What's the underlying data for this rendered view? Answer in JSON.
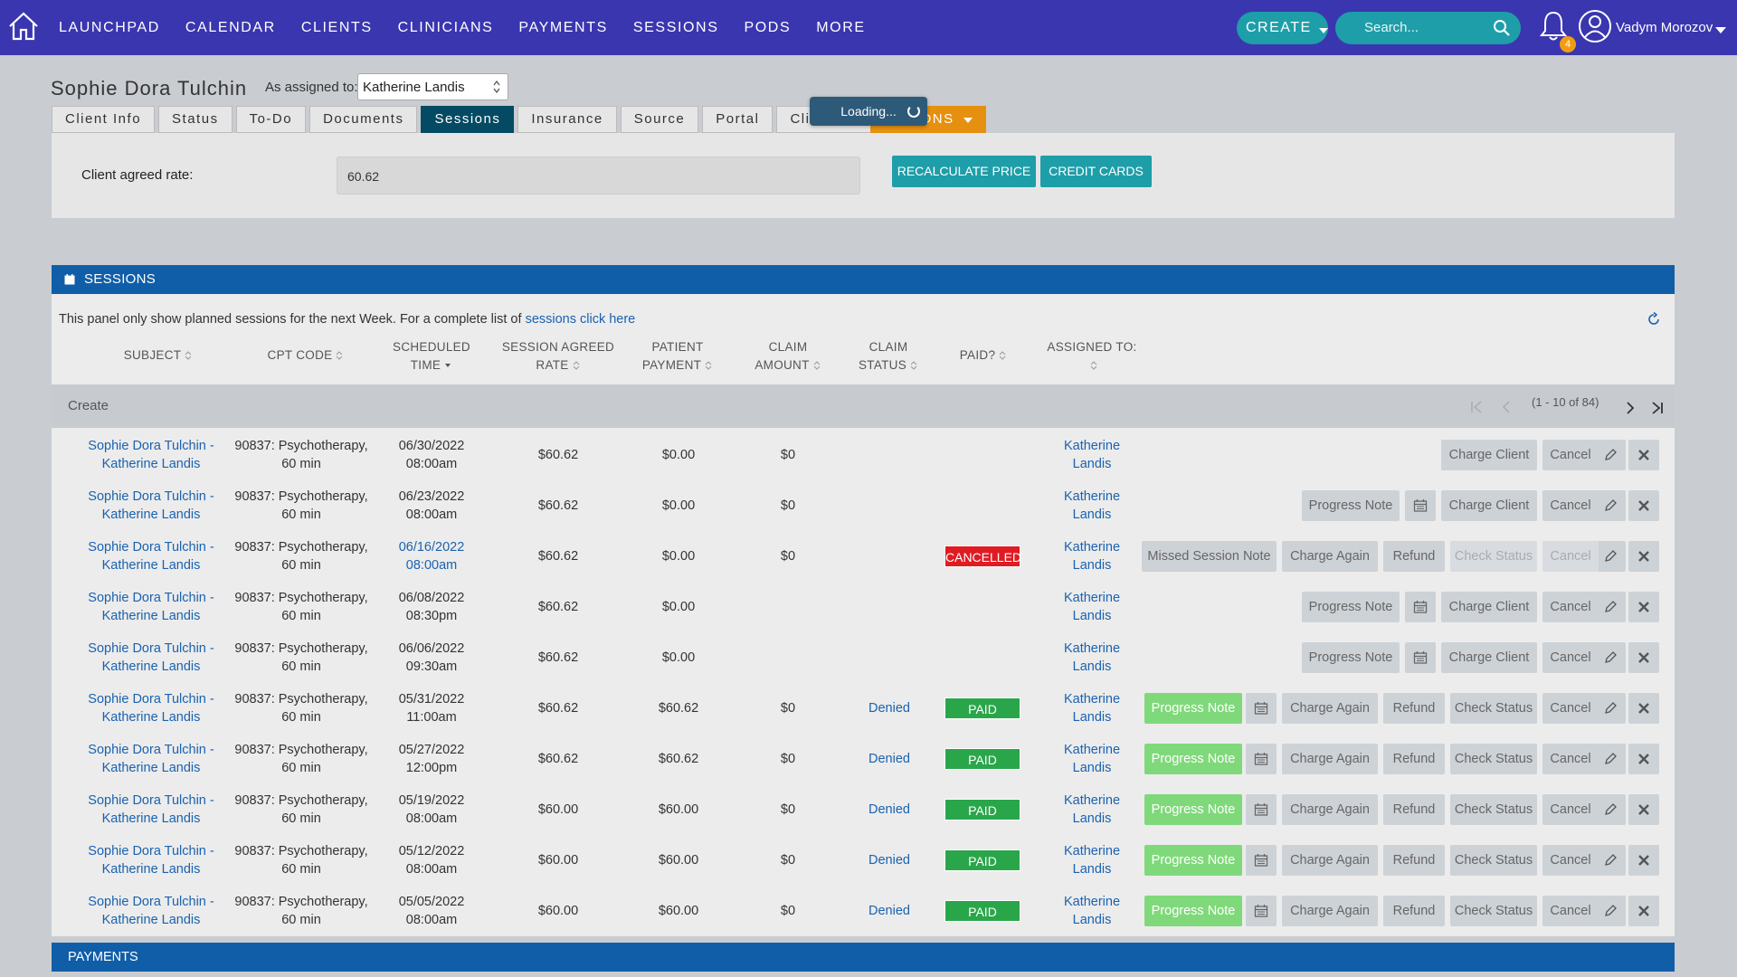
{
  "nav": {
    "links": [
      "LAUNCHPAD",
      "CALENDAR",
      "CLIENTS",
      "CLINICIANS",
      "PAYMENTS",
      "SESSIONS",
      "PODS",
      "MORE"
    ],
    "create_label": "CREATE",
    "search_placeholder": "Search...",
    "notification_count": "4",
    "user_name": "Vadym Morozov"
  },
  "header": {
    "client_name": "Sophie Dora Tulchin",
    "assigned_label": "As assigned to:",
    "assigned_value": "Katherine Landis",
    "tabs": [
      "Client Info",
      "Status",
      "To-Do",
      "Documents",
      "Sessions",
      "Insurance",
      "Source",
      "Portal",
      "Clinicians"
    ],
    "active_tab": "Sessions",
    "actions_label": "ACTIONS",
    "loading_text": "Loading..."
  },
  "rate": {
    "label": "Client agreed rate:",
    "value": "60.62",
    "recalc_label": "RECALCULATE PRICE",
    "cards_label": "CREDIT CARDS"
  },
  "sessions": {
    "title": "SESSIONS",
    "info_text": "This panel only show planned sessions for the next Week. For a complete list of ",
    "info_link": "sessions click here",
    "columns": {
      "subject": "SUBJECT",
      "cpt": "CPT CODE",
      "sched1": "SCHEDULED",
      "sched2": "TIME",
      "rate1": "SESSION AGREED",
      "rate2": "RATE",
      "patient1": "PATIENT",
      "patient2": "PAYMENT",
      "claim1": "CLAIM",
      "claim2": "AMOUNT",
      "cstatus1": "CLAIM",
      "cstatus2": "STATUS",
      "paid": "PAID?",
      "assigned": "ASSIGNED TO:"
    },
    "create_label": "Create",
    "pager_text": "(1 - 10 of 84)",
    "rows": [
      {
        "subject1": "Sophie Dora Tulchin -",
        "subject2": "Katherine Landis",
        "cpt1": "90837: Psychotherapy,",
        "cpt2": "60 min",
        "date": "06/30/2022",
        "time": "08:00am",
        "rate": "$60.62",
        "payment": "$0.00",
        "claim": "$0",
        "claim_status": "",
        "paid": "",
        "assigned1": "Katherine",
        "assigned2": "Landis"
      },
      {
        "subject1": "Sophie Dora Tulchin -",
        "subject2": "Katherine Landis",
        "cpt1": "90837: Psychotherapy,",
        "cpt2": "60 min",
        "date": "06/23/2022",
        "time": "08:00am",
        "rate": "$60.62",
        "payment": "$0.00",
        "claim": "$0",
        "claim_status": "",
        "paid": "",
        "assigned1": "Katherine",
        "assigned2": "Landis"
      },
      {
        "subject1": "Sophie Dora Tulchin -",
        "subject2": "Katherine Landis",
        "cpt1": "90837: Psychotherapy,",
        "cpt2": "60 min",
        "date": "06/16/2022",
        "time": "08:00am",
        "rate": "$60.62",
        "payment": "$0.00",
        "claim": "$0",
        "claim_status": "",
        "paid": "CANCELLED",
        "assigned1": "Katherine",
        "assigned2": "Landis"
      },
      {
        "subject1": "Sophie Dora Tulchin -",
        "subject2": "Katherine Landis",
        "cpt1": "90837: Psychotherapy,",
        "cpt2": "60 min",
        "date": "06/08/2022",
        "time": "08:30pm",
        "rate": "$60.62",
        "payment": "$0.00",
        "claim": "",
        "claim_status": "",
        "paid": "",
        "assigned1": "Katherine",
        "assigned2": "Landis"
      },
      {
        "subject1": "Sophie Dora Tulchin -",
        "subject2": "Katherine Landis",
        "cpt1": "90837: Psychotherapy,",
        "cpt2": "60 min",
        "date": "06/06/2022",
        "time": "09:30am",
        "rate": "$60.62",
        "payment": "$0.00",
        "claim": "",
        "claim_status": "",
        "paid": "",
        "assigned1": "Katherine",
        "assigned2": "Landis"
      },
      {
        "subject1": "Sophie Dora Tulchin -",
        "subject2": "Katherine Landis",
        "cpt1": "90837: Psychotherapy,",
        "cpt2": "60 min",
        "date": "05/31/2022",
        "time": "11:00am",
        "rate": "$60.62",
        "payment": "$60.62",
        "claim": "$0",
        "claim_status": "Denied",
        "paid": "PAID",
        "assigned1": "Katherine",
        "assigned2": "Landis"
      },
      {
        "subject1": "Sophie Dora Tulchin -",
        "subject2": "Katherine Landis",
        "cpt1": "90837: Psychotherapy,",
        "cpt2": "60 min",
        "date": "05/27/2022",
        "time": "12:00pm",
        "rate": "$60.62",
        "payment": "$60.62",
        "claim": "$0",
        "claim_status": "Denied",
        "paid": "PAID",
        "assigned1": "Katherine",
        "assigned2": "Landis"
      },
      {
        "subject1": "Sophie Dora Tulchin -",
        "subject2": "Katherine Landis",
        "cpt1": "90837: Psychotherapy,",
        "cpt2": "60 min",
        "date": "05/19/2022",
        "time": "08:00am",
        "rate": "$60.00",
        "payment": "$60.00",
        "claim": "$0",
        "claim_status": "Denied",
        "paid": "PAID",
        "assigned1": "Katherine",
        "assigned2": "Landis"
      },
      {
        "subject1": "Sophie Dora Tulchin -",
        "subject2": "Katherine Landis",
        "cpt1": "90837: Psychotherapy,",
        "cpt2": "60 min",
        "date": "05/12/2022",
        "time": "08:00am",
        "rate": "$60.00",
        "payment": "$60.00",
        "claim": "$0",
        "claim_status": "Denied",
        "paid": "PAID",
        "assigned1": "Katherine",
        "assigned2": "Landis"
      },
      {
        "subject1": "Sophie Dora Tulchin -",
        "subject2": "Katherine Landis",
        "cpt1": "90837: Psychotherapy,",
        "cpt2": "60 min",
        "date": "05/05/2022",
        "time": "08:00am",
        "rate": "$60.00",
        "payment": "$60.00",
        "claim": "$0",
        "claim_status": "Denied",
        "paid": "PAID",
        "assigned1": "Katherine",
        "assigned2": "Landis"
      }
    ],
    "buttons": {
      "charge_client": "Charge Client",
      "cancel": "Cancel",
      "progress_note": "Progress Note",
      "missed_note": "Missed Session Note",
      "charge_again": "Charge Again",
      "refund": "Refund",
      "check_status": "Check Status"
    }
  },
  "payments": {
    "title": "PAYMENTS"
  },
  "colors": {
    "nav_bg": "#3a36b0",
    "teal": "#1e9ea8",
    "panel_blue": "#105ea8",
    "active_tab": "#054a63",
    "actions_orange": "#e6900f",
    "paid_green": "#2aa64a",
    "cancel_red": "#e01b22",
    "progress_green": "#7fd97a"
  }
}
